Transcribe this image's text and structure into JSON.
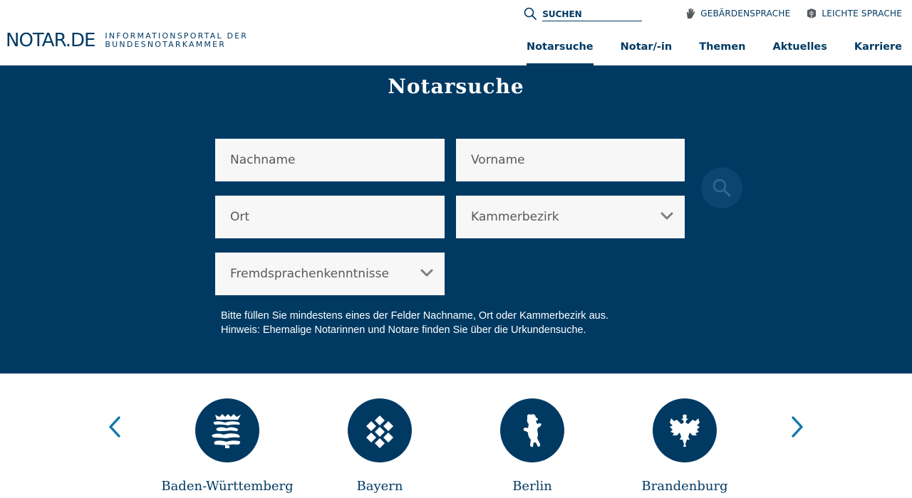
{
  "header": {
    "logo": "NOTAR.DE",
    "logo_subtitle": [
      "INFORMATIONSPORTAL DER",
      "BUNDESNOTARKAMMER"
    ],
    "search_placeholder": "SUCHEN",
    "utility_links": [
      {
        "label": "GEBÄRDENSPRACHE",
        "icon": "hand-icon"
      },
      {
        "label": "LEICHTE SPRACHE",
        "icon": "easy-language-icon"
      }
    ],
    "nav": [
      {
        "label": "Notarsuche",
        "active": true
      },
      {
        "label": "Notar/-in",
        "active": false
      },
      {
        "label": "Themen",
        "active": false
      },
      {
        "label": "Aktuelles",
        "active": false
      },
      {
        "label": "Karriere",
        "active": false
      }
    ]
  },
  "hero": {
    "title": "Notarsuche",
    "fields": {
      "nachname_placeholder": "Nachname",
      "vorname_placeholder": "Vorname",
      "ort_placeholder": "Ort",
      "kammerbezirk_selected": "Kammerbezirk",
      "fremdsprachen_selected": "Fremdsprachenkenntnisse"
    },
    "hint_lines": [
      "Bitte füllen Sie mindestens eines der Felder Nachname, Ort oder Kammerbezirk aus.",
      "Hinweis: Ehemalige Notarinnen und Notare finden Sie über die Urkundensuche."
    ]
  },
  "carousel": {
    "states": [
      {
        "name": "Baden-Württemberg",
        "icon": "baden-wuerttemberg-coat-of-arms-icon"
      },
      {
        "name": "Bayern",
        "icon": "bayern-coat-of-arms-icon"
      },
      {
        "name": "Berlin",
        "icon": "berlin-bear-icon"
      },
      {
        "name": "Brandenburg",
        "icon": "brandenburg-eagle-icon"
      }
    ]
  },
  "colors": {
    "primary": "#003a63",
    "field_bg": "#f7f7f7",
    "field_text": "#555a5e",
    "search_button": "#0b4570",
    "carousel_arrow": "#1477a8"
  }
}
